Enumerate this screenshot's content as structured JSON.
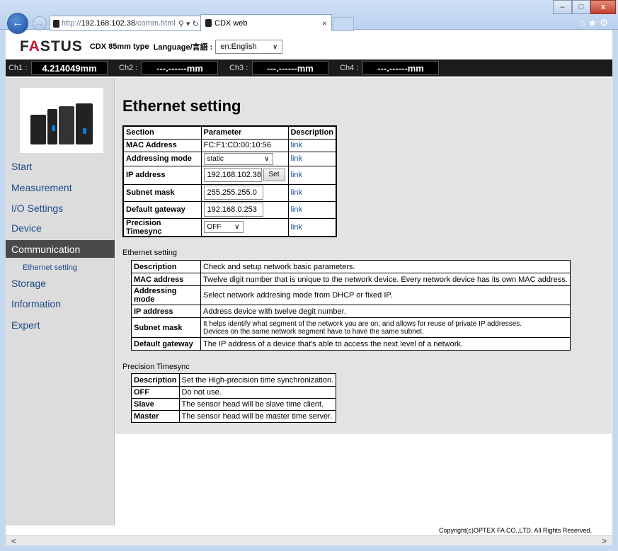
{
  "browser": {
    "address_prefix": "http://",
    "address_host": "192.168.102.38",
    "address_path": "/comm.html",
    "address_controls": "⚲ ▾ ↻",
    "tab_title": "CDX web",
    "tab_close": "×",
    "back_glyph": "←",
    "fwd_glyph": "→",
    "min_glyph": "–",
    "max_glyph": "□",
    "close_glyph": "x",
    "tool_icons": "⌂★⚙",
    "scroll_left": "<",
    "scroll_right": ">"
  },
  "header": {
    "logo_pre": "F",
    "logo_accent": "A",
    "logo_post": "STUS",
    "model": "CDX 85mm type",
    "language_label": "Language/言語 :",
    "language_value": "en:English",
    "chevron": "∨"
  },
  "channels": [
    {
      "label": "Ch1 :",
      "value": "4.214049mm"
    },
    {
      "label": "Ch2 :",
      "value": "---.------mm"
    },
    {
      "label": "Ch3 :",
      "value": "---.------mm"
    },
    {
      "label": "Ch4 :",
      "value": "---.------mm"
    }
  ],
  "sidebar": {
    "items": [
      "Start",
      "Measurement",
      "I/O Settings",
      "Device",
      "Communication",
      "Storage",
      "Information",
      "Expert"
    ],
    "sub_item": "Ethernet setting"
  },
  "main": {
    "title": "Ethernet setting",
    "settings": {
      "headers": [
        "Section",
        "Parameter",
        "Description"
      ],
      "mac_label": "MAC Address",
      "mac_value": "FC:F1:CD:00:10:56",
      "addressing_label": "Addressing mode",
      "addressing_value": "static",
      "ip_label": "IP address",
      "ip_value": "192.168.102.38",
      "set_button": "Set",
      "subnet_label": "Subnet mask",
      "subnet_value": "255.255.255.0",
      "gateway_label": "Default gateway",
      "gateway_value": "192.168.0.253",
      "timesync_label": "Precision Timesync",
      "timesync_value": "OFF",
      "link": "link"
    },
    "eth_caption": "Ethernet setting",
    "eth_rows": [
      {
        "k": "Description",
        "v": "Check and setup network basic parameters."
      },
      {
        "k": "MAC address",
        "v": "Twelve digit number that is unique to the network device. Every network device has its own MAC address."
      },
      {
        "k": "Addressing mode",
        "v": "Select network addresing mode from DHCP or fixed IP."
      },
      {
        "k": "IP address",
        "v": "Address device with twelve degit number."
      },
      {
        "k": "Subnet mask",
        "v": "It helps identify what segment of the network you are on, and allows for reuse of private IP addresses.",
        "v2": "Devices on the same network segment have to have the same subnet."
      },
      {
        "k": "Default gateway",
        "v": "The IP address of a device that's able to access the next level of a network."
      }
    ],
    "ts_caption": "Precision Timesync",
    "ts_rows": [
      {
        "k": "Description",
        "v": "Set the High-precision time synchronization."
      },
      {
        "k": "OFF",
        "v": "Do not use."
      },
      {
        "k": "Slave",
        "v": "The sensor head will be slave time client."
      },
      {
        "k": "Master",
        "v": "The sensor head will be master time server."
      }
    ]
  },
  "footer": {
    "copyright": "Copyright(c)OPTEX FA CO.,LTD. All Rights Reserved."
  }
}
